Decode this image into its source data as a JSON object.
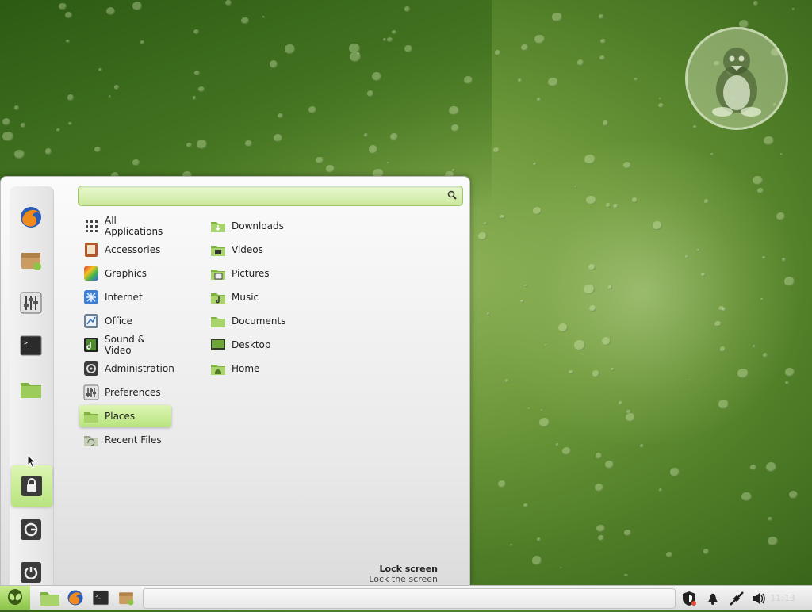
{
  "menu": {
    "search": {
      "value": "",
      "placeholder": ""
    },
    "categories": [
      {
        "label": "All Applications"
      },
      {
        "label": "Accessories"
      },
      {
        "label": "Graphics"
      },
      {
        "label": "Internet"
      },
      {
        "label": "Office"
      },
      {
        "label": "Sound & Video"
      },
      {
        "label": "Administration"
      },
      {
        "label": "Preferences"
      },
      {
        "label": "Places",
        "selected": true
      },
      {
        "label": "Recent Files"
      }
    ],
    "places": [
      {
        "label": "Downloads"
      },
      {
        "label": "Videos"
      },
      {
        "label": "Pictures"
      },
      {
        "label": "Music"
      },
      {
        "label": "Documents"
      },
      {
        "label": "Desktop"
      },
      {
        "label": "Home"
      }
    ],
    "favorites": [
      "firefox-icon",
      "software-manager-icon",
      "system-settings-icon",
      "terminal-icon",
      "files-icon"
    ],
    "session_buttons": [
      "lock-screen-icon",
      "logout-icon",
      "shutdown-icon"
    ],
    "description": {
      "title": "Lock screen",
      "subtitle": "Lock the screen"
    }
  },
  "panel": {
    "launchers": [
      "files-icon",
      "firefox-icon",
      "terminal-icon",
      "software-manager-icon"
    ],
    "tray": [
      "shield-icon",
      "notifications-icon",
      "network-icon",
      "volume-icon"
    ],
    "clock": "11:13"
  },
  "colors": {
    "accent": "#b8e47e",
    "accent_border": "#9cc767",
    "wallpaper": "#5a8a2e"
  }
}
